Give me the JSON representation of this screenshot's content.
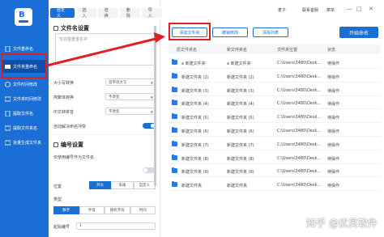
{
  "sidebar": {
    "items": [
      {
        "label": "文件重命名"
      },
      {
        "label": "文件夹重命名"
      },
      {
        "label": "文件时间修改"
      },
      {
        "label": "文件夹时间修改"
      },
      {
        "label": "提取文件名"
      },
      {
        "label": "提取文件夹名"
      },
      {
        "label": "批量生成文件夹"
      }
    ],
    "active_index": 1
  },
  "tabs": [
    "自定义",
    "插入",
    "替换",
    "删除",
    "导入"
  ],
  "file_name_settings": {
    "title": "文件名设置",
    "textbox_placeholder": "仅完整重置名字",
    "rows": [
      {
        "label": "大小写转换",
        "value": "首字母大写"
      },
      {
        "label": "简繁体转换",
        "value": "不改变"
      },
      {
        "label": "中文转拼音",
        "value": "不改变"
      },
      {
        "label": "自动解决命名冲突",
        "toggle": true
      }
    ]
  },
  "numbering_settings": {
    "title": "编号设置",
    "only_when_needed": "仅使用编号作为文件名",
    "position_label": "位置",
    "position_options": [
      "开头",
      "末尾",
      "自定义"
    ],
    "type_label": "类型",
    "type_options": [
      "数字",
      "字母",
      "随机字符",
      "时间"
    ],
    "start_label": "起始编号",
    "start_value": "1"
  },
  "toolbar": {
    "add_folder": "添加文件夹",
    "undo": "撤销修改",
    "clear": "清除列表",
    "start": "开始命名"
  },
  "titlebar": {
    "user": "麦子",
    "contact": "联系客服",
    "menu": "菜单"
  },
  "table": {
    "headers": [
      "原文件夹名",
      "新文件夹名",
      "文件夹位置",
      "状态"
    ],
    "rows": [
      {
        "orig": "a 新建文件夹",
        "new": "a 新建文件夹",
        "path": "C:\\Users\\3480\\Desk...",
        "status": "待操作"
      },
      {
        "orig": "新建文件夹 (2)",
        "new": "新建文件夹 (2)",
        "path": "C:\\Users\\3480\\Desk...",
        "status": "待操作"
      },
      {
        "orig": "新建文件夹 (3)",
        "new": "新建文件夹 (3)",
        "path": "C:\\Users\\3480\\Desk...",
        "status": "待操作"
      },
      {
        "orig": "新建文件夹 (4)",
        "new": "新建文件夹 (4)",
        "path": "C:\\Users\\3480\\Desk...",
        "status": "待操作"
      },
      {
        "orig": "新建文件夹 (5)",
        "new": "新建文件夹 (5)",
        "path": "C:\\Users\\3480\\Desk...",
        "status": "待操作"
      },
      {
        "orig": "新建文件夹 (6)",
        "new": "新建文件夹 (6)",
        "path": "C:\\Users\\3480\\Desk...",
        "status": "待操作"
      },
      {
        "orig": "新建文件夹 (7)",
        "new": "新建文件夹 (7)",
        "path": "C:\\Users\\3480\\Desk...",
        "status": "待操作"
      },
      {
        "orig": "新建文件夹 (8)",
        "new": "新建文件夹 (8)",
        "path": "C:\\Users\\3480\\Desk...",
        "status": "待操作"
      },
      {
        "orig": "新建文件夹 (9)",
        "new": "新建文件夹 (9)",
        "path": "C:\\Users\\3480\\Desk...",
        "status": "待操作"
      },
      {
        "orig": "新建文件夹",
        "new": "新建文件夹",
        "path": "C:\\Users\\3480\\Desk...",
        "status": "待操作"
      }
    ]
  },
  "watermark": "知乎 @优灵软件",
  "colors": {
    "accent": "#1a6fd6",
    "highlight": "#e02020"
  }
}
